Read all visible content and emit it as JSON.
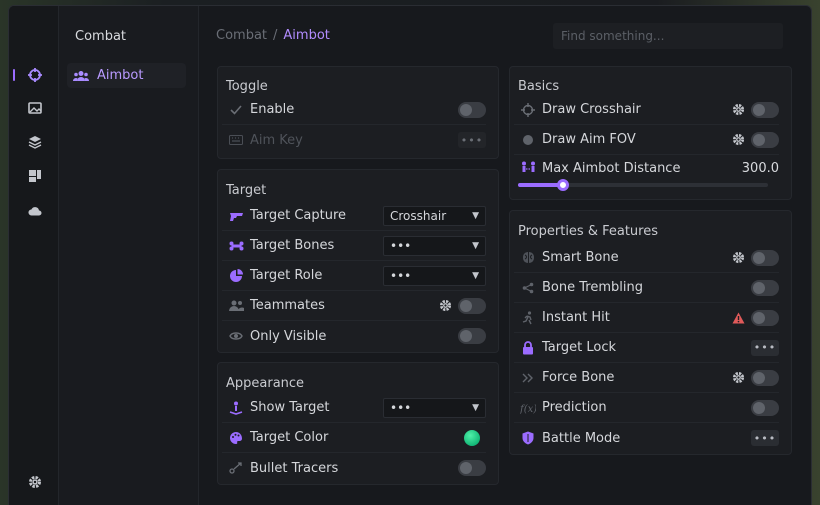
{
  "nav": {
    "section_title": "Combat",
    "items": [
      {
        "label": "Aimbot"
      }
    ]
  },
  "breadcrumb": {
    "parent": "Combat",
    "separator": "/",
    "current": "Aimbot"
  },
  "search": {
    "placeholder": "Find something..."
  },
  "colors": {
    "accent": "#9b6cff",
    "target_color": "#22d18b",
    "warning": "#e05a5a"
  },
  "toggle_card": {
    "title": "Toggle",
    "rows": [
      {
        "label": "Enable",
        "icon": "check-icon",
        "control": "toggle",
        "on": false
      },
      {
        "label": "Aim Key",
        "icon": "keyboard-icon",
        "control": "dots",
        "disabled": true,
        "button": "•••"
      }
    ]
  },
  "target_card": {
    "title": "Target",
    "rows": [
      {
        "label": "Target Capture",
        "icon": "gun-icon",
        "control": "select",
        "value": "Crosshair"
      },
      {
        "label": "Target Bones",
        "icon": "bone-icon",
        "control": "select",
        "value": "•••"
      },
      {
        "label": "Target Role",
        "icon": "pie-chart-icon",
        "control": "select",
        "value": "•••"
      },
      {
        "label": "Teammates",
        "icon": "users-icon",
        "control": "toggle",
        "settings": true,
        "on": false
      },
      {
        "label": "Only Visible",
        "icon": "eye-icon",
        "control": "toggle",
        "on": false
      }
    ]
  },
  "appearance_card": {
    "title": "Appearance",
    "rows": [
      {
        "label": "Show Target",
        "icon": "target-person-icon",
        "control": "select",
        "value": "•••"
      },
      {
        "label": "Target Color",
        "icon": "palette-icon",
        "control": "color"
      },
      {
        "label": "Bullet Tracers",
        "icon": "tracer-icon",
        "control": "toggle",
        "on": false
      }
    ]
  },
  "basics_card": {
    "title": "Basics",
    "rows": [
      {
        "label": "Draw Crosshair",
        "icon": "crosshair-icon",
        "control": "toggle",
        "settings": true,
        "on": false
      },
      {
        "label": "Draw Aim FOV",
        "icon": "circle-icon",
        "control": "toggle",
        "settings": true,
        "on": false
      }
    ],
    "slider": {
      "label": "Max Aimbot Distance",
      "icon": "distance-icon",
      "value": "300.0",
      "fraction": 0.18
    }
  },
  "features_card": {
    "title": "Properties & Features",
    "rows": [
      {
        "label": "Smart Bone",
        "icon": "brain-icon",
        "control": "toggle",
        "settings": true,
        "on": false
      },
      {
        "label": "Bone Trembling",
        "icon": "share-icon",
        "control": "toggle",
        "on": false
      },
      {
        "label": "Instant Hit",
        "icon": "running-icon",
        "control": "toggle",
        "warning": true,
        "on": false
      },
      {
        "label": "Target Lock",
        "icon": "lock-icon",
        "control": "dots",
        "button": "•••"
      },
      {
        "label": "Force Bone",
        "icon": "double-chevron-icon",
        "control": "toggle",
        "settings": true,
        "on": false
      },
      {
        "label": "Prediction",
        "icon": "function-icon",
        "control": "toggle",
        "on": false
      },
      {
        "label": "Battle Mode",
        "icon": "shield-icon",
        "control": "dots",
        "button": "•••"
      }
    ]
  }
}
